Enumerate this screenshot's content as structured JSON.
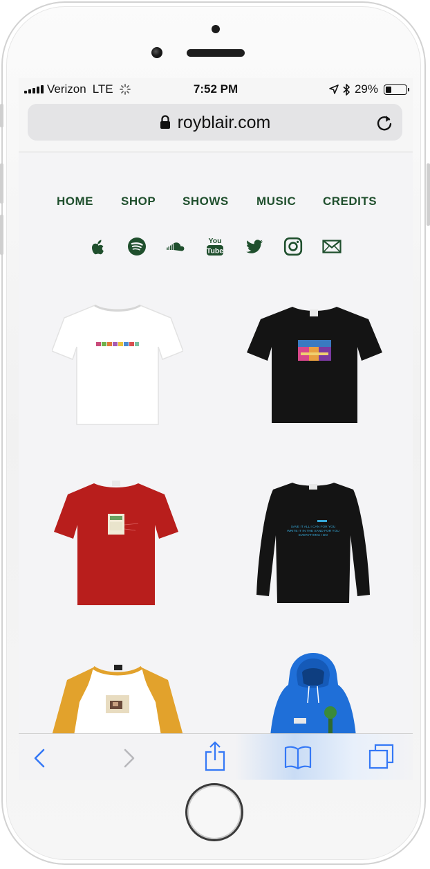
{
  "status_bar": {
    "carrier": "Verizon",
    "network": "LTE",
    "time": "7:52 PM",
    "battery": "29%",
    "battery_level": 0.29
  },
  "browser": {
    "url": "royblair.com"
  },
  "nav": {
    "items": [
      {
        "label": "HOME"
      },
      {
        "label": "SHOP"
      },
      {
        "label": "SHOWS"
      },
      {
        "label": "MUSIC"
      },
      {
        "label": "CREDITS"
      }
    ]
  },
  "social": [
    "apple-icon",
    "spotify-icon",
    "soundcloud-icon",
    "youtube-icon",
    "twitter-icon",
    "instagram-icon",
    "email-icon"
  ],
  "colors": {
    "accent": "#1f4f2d",
    "ios_blue": "#3478f6",
    "page_bg": "#f4f4f6"
  },
  "products": {
    "items": [
      {
        "name": "white-tee"
      },
      {
        "name": "black-tee"
      },
      {
        "name": "red-tee"
      },
      {
        "name": "black-longsleeve"
      },
      {
        "name": "raglan-tee"
      },
      {
        "name": "blue-hoodie"
      }
    ],
    "longsleeve_text": "SAVE IT ALL I CAN FOR YOU WRITE IT IN THE SAND FOR YOU EVERYTHING I DO"
  }
}
